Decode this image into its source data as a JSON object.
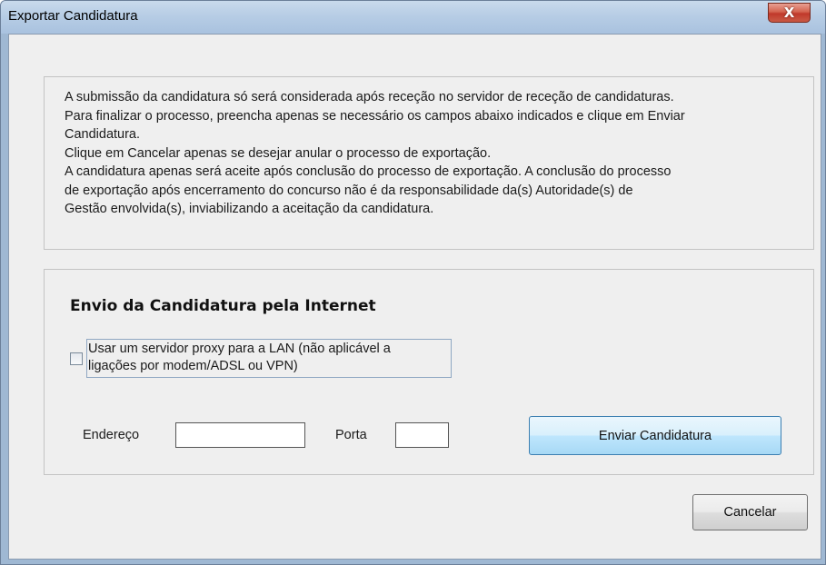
{
  "window": {
    "title": "Exportar Candidatura",
    "close_glyph": "X"
  },
  "info": {
    "lines": [
      "A submissão da candidatura só será considerada após receção no servidor de receção de candidaturas.",
      "Para finalizar o processo, preencha apenas se necessário os campos abaixo indicados e clique em Enviar",
      "Candidatura.",
      "Clique em Cancelar apenas se desejar anular o processo de exportação.",
      "A candidatura apenas será aceite após conclusão do processo de exportação. A conclusão do processo",
      "de exportação após encerramento do concurso não é da responsabilidade da(s) Autoridade(s) de",
      "Gestão envolvida(s), inviabilizando a aceitação da candidatura."
    ]
  },
  "internet": {
    "section_title": "Envio da Candidatura pela Internet",
    "proxy_checkbox": {
      "checked": false,
      "label_line1": "Usar um servidor proxy para a LAN (não aplicável a",
      "label_line2": "ligações por modem/ADSL ou VPN)"
    },
    "address_label": "Endereço",
    "address_value": "",
    "port_label": "Porta",
    "port_value": "",
    "send_button": "Enviar Candidatura"
  },
  "footer": {
    "cancel_button": "Cancelar"
  },
  "colors": {
    "titlebar": "#b7cde5",
    "close_button": "#c0392b",
    "dialog_background": "#efefef",
    "primary_button": "#bee6fd"
  }
}
